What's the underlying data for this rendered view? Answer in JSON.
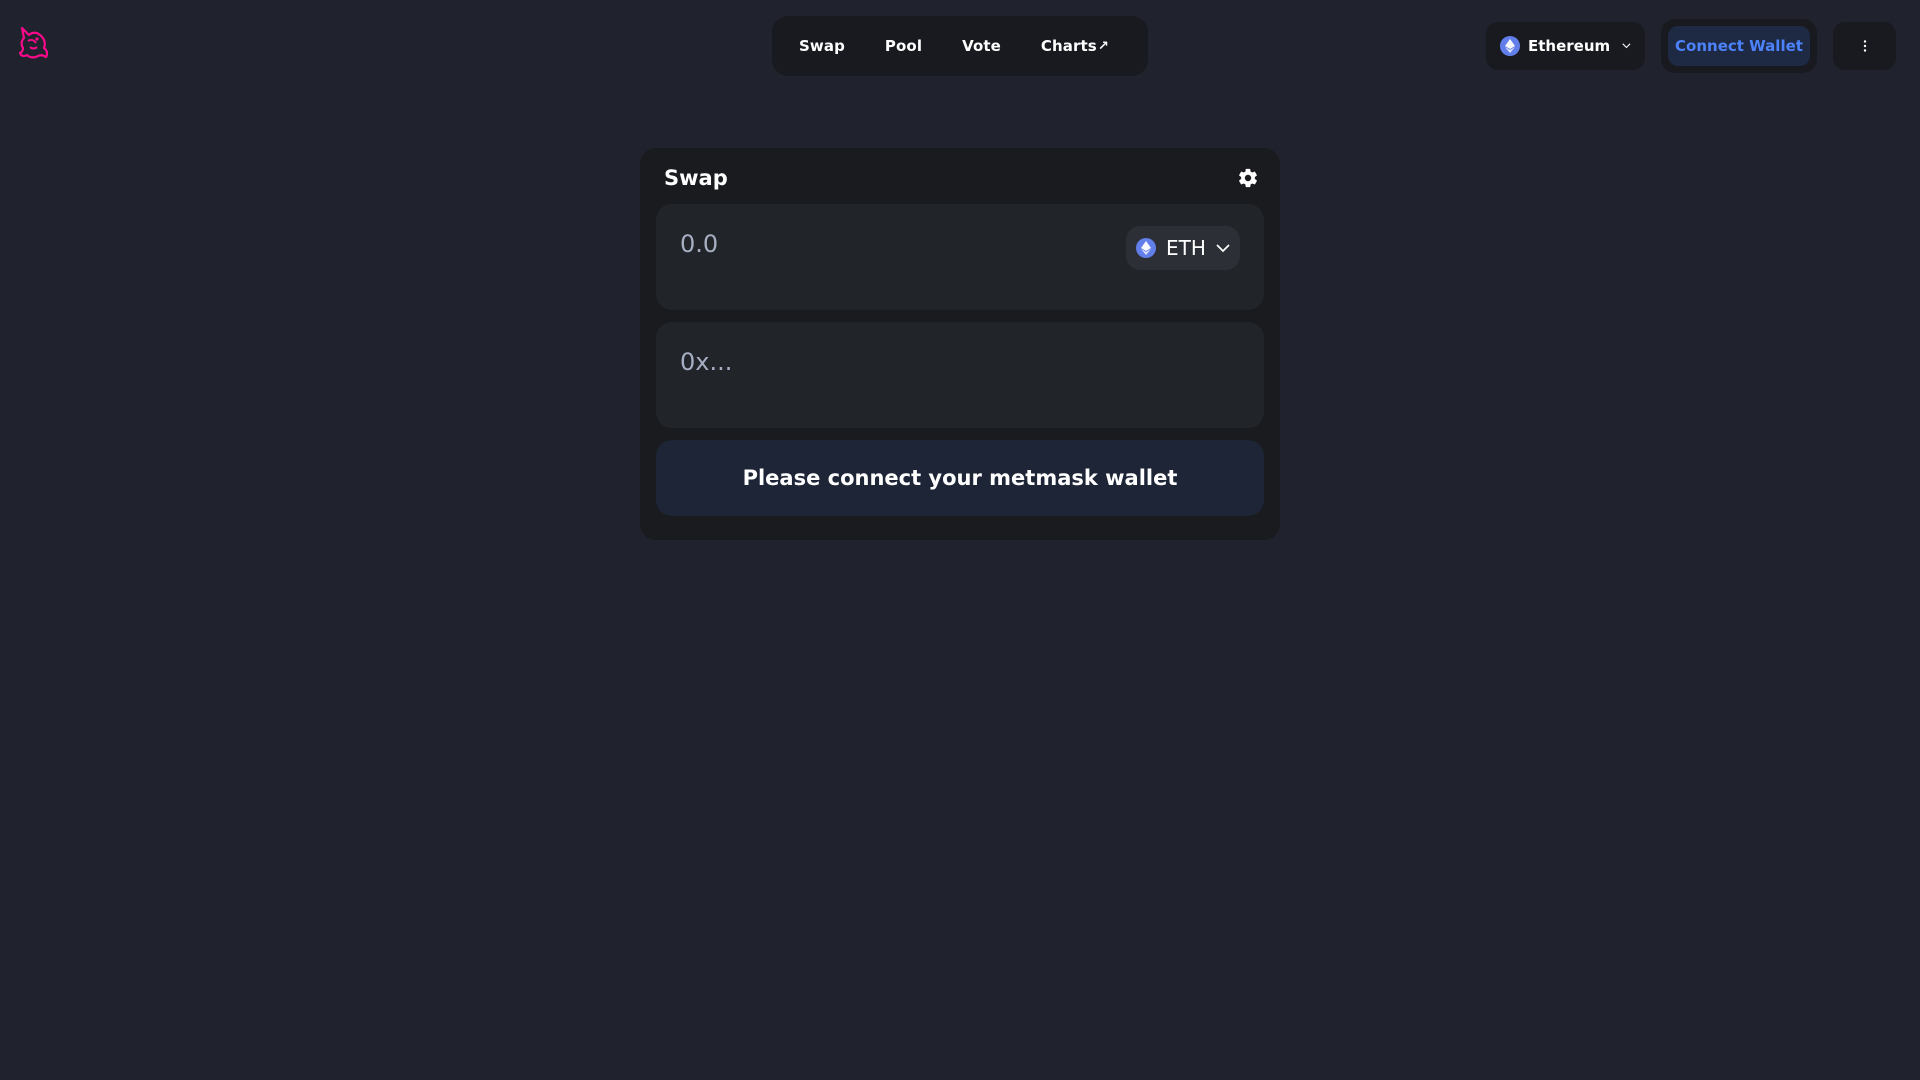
{
  "header": {
    "nav": {
      "items": [
        {
          "label": "Swap"
        },
        {
          "label": "Pool"
        },
        {
          "label": "Vote"
        },
        {
          "label": "Charts",
          "suffix": "↗"
        }
      ]
    },
    "network": {
      "label": "Ethereum",
      "icon": "ethereum-icon"
    },
    "wallet": {
      "connect_label": "Connect Wallet",
      "color": "#4c82fb"
    },
    "menu": {
      "icon": "more-vertical-icon"
    }
  },
  "swap": {
    "title": "Swap",
    "settings_icon": "gear-icon",
    "amount": {
      "value": "",
      "placeholder": "0.0"
    },
    "token": {
      "symbol": "ETH",
      "icon": "ethereum-icon"
    },
    "address": {
      "value": "",
      "placeholder": "0x..."
    },
    "submit_label": "Please connect your metmask wallet"
  },
  "colors": {
    "background": "#20232e",
    "surface": "#191b1f",
    "panel": "#212429",
    "accent": "#4c82fb",
    "logo": "#fc0a8b",
    "ethereum": "#627eea"
  }
}
